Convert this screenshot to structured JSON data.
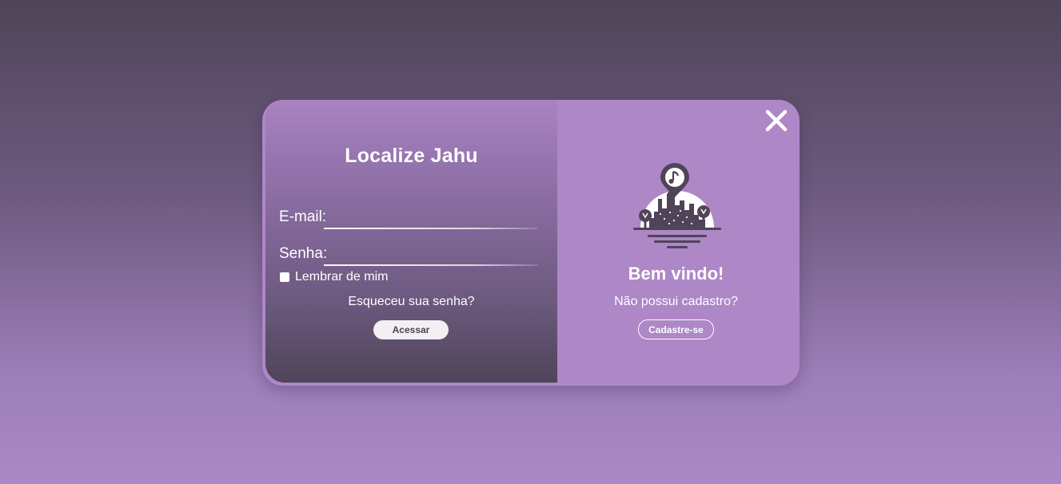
{
  "login": {
    "title": "Localize Jahu",
    "email_label": "E-mail:",
    "password_label": "Senha:",
    "remember_label": "Lembrar de mim",
    "remember_checked": false,
    "forgot_label": "Esqueceu sua senha?",
    "submit_label": "Acessar"
  },
  "welcome": {
    "title": "Bem vindo!",
    "subtitle": "Não possui cadastro?",
    "register_label": "Cadastre-se",
    "close_icon": "close-icon",
    "logo_icon": "city-music-pin-icon"
  },
  "colors": {
    "accent_purple": "#ad87c6",
    "dark_purple": "#4f4458",
    "button_light": "#f2f0f3"
  }
}
